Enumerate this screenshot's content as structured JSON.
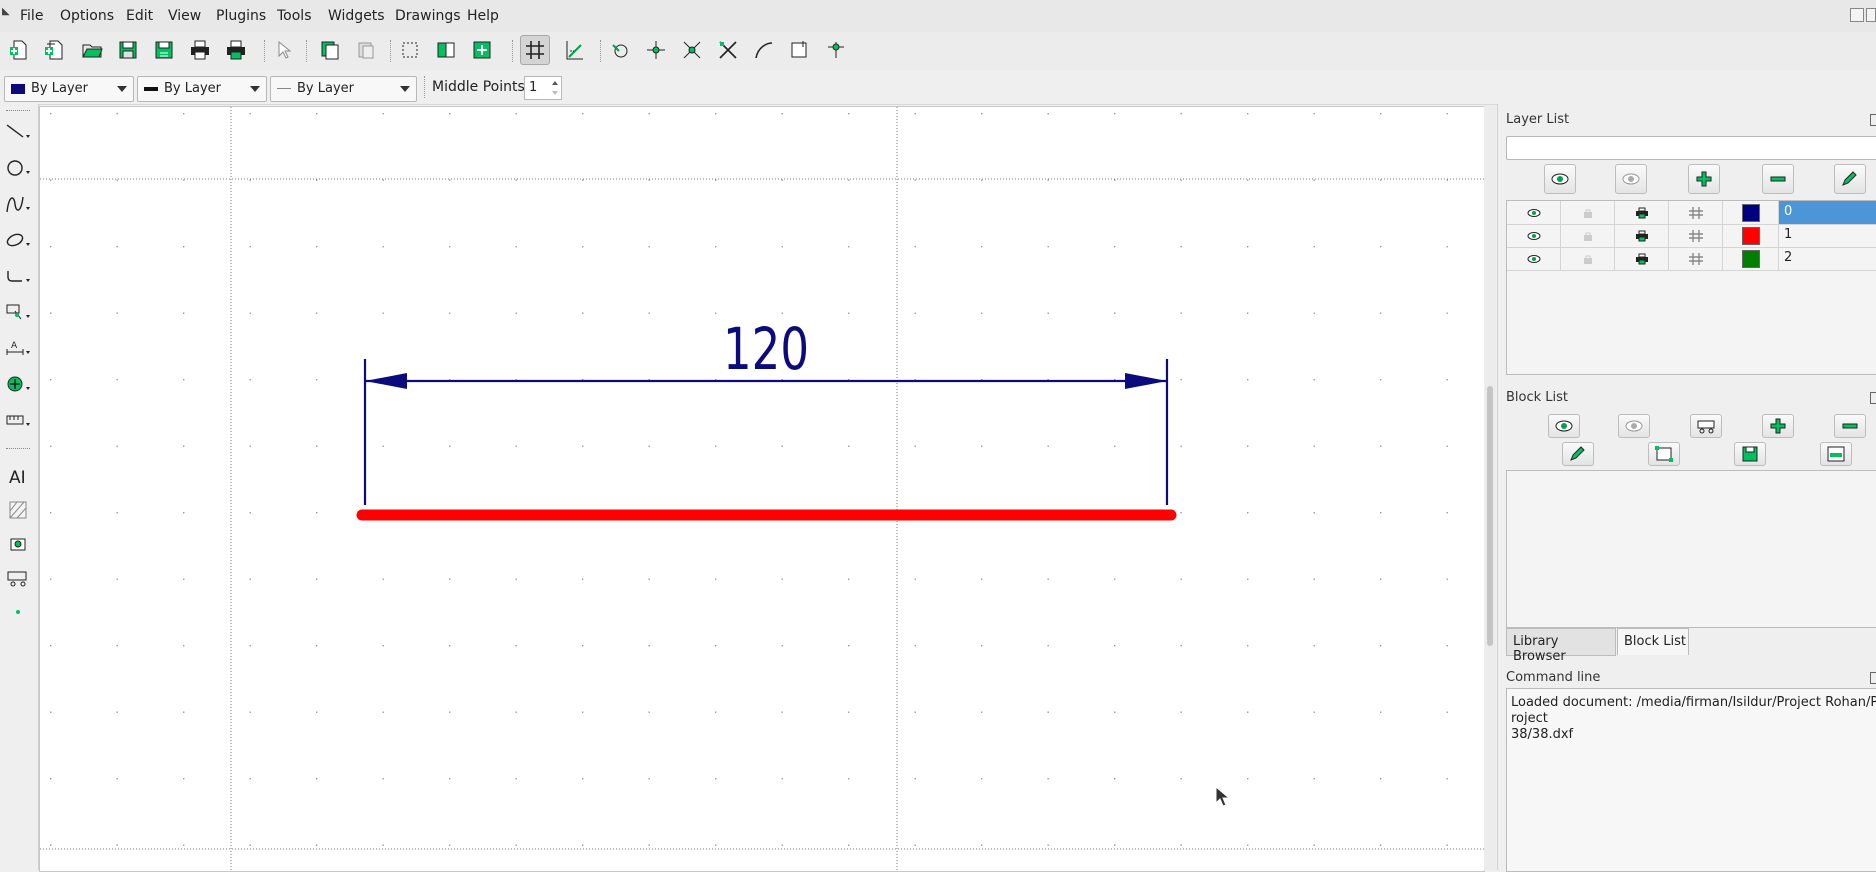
{
  "menubar": {
    "items": [
      "File",
      "Options",
      "Edit",
      "View",
      "Plugins",
      "Tools",
      "Widgets",
      "Drawings",
      "Help"
    ]
  },
  "toolbar": {
    "buttons": [
      "new-document-icon",
      "new-from-template-icon",
      "open-folder-icon",
      "save-icon",
      "save-as-icon",
      "print-icon",
      "print-preview-icon",
      "select-pointer-icon",
      "copy-icon",
      "cut-icon",
      "selection-window-icon",
      "block-insert-icon",
      "block-create-icon",
      "grid-icon",
      "snap-guide-icon",
      "snap-free-icon",
      "snap-grid-icon",
      "snap-endpoint-icon",
      "snap-on-entity-icon",
      "snap-center-icon",
      "snap-middle-icon",
      "snap-distance-icon"
    ]
  },
  "pen": {
    "color_label": "By Layer",
    "color_swatch": "#0a0a7a",
    "width_label": "By Layer",
    "linetype_label": "By Layer",
    "middle_points_label": "Middle Points:",
    "middle_points_value": "1"
  },
  "drawing": {
    "dimension_text": "120",
    "dimension_color": "#0b0b7c",
    "line_color": "#ff0000"
  },
  "layer_list": {
    "title": "Layer List",
    "search_value": "",
    "buttons": [
      "show-all-layers-icon",
      "hide-all-layers-icon",
      "add-layer-icon",
      "remove-layer-icon",
      "edit-layer-icon"
    ],
    "layers": [
      {
        "name": "0",
        "color": "#00007f",
        "selected": true
      },
      {
        "name": "1",
        "color": "#ff0000",
        "selected": false
      },
      {
        "name": "2",
        "color": "#007f00",
        "selected": false
      }
    ]
  },
  "block_list": {
    "title": "Block List",
    "buttons": [
      "show-all-blocks-icon",
      "hide-all-blocks-icon",
      "create-block-icon",
      "add-block-icon",
      "remove-block-icon",
      "rename-block-icon",
      "edit-block-icon",
      "save-block-icon",
      "insert-block-icon"
    ]
  },
  "tabs": {
    "library_browser": "Library Browser",
    "block_list": "Block List"
  },
  "command_line": {
    "title": "Command line",
    "log": "Loaded document: /media/firman/Isildur/Project Rohan/Project\n38/38.dxf"
  }
}
